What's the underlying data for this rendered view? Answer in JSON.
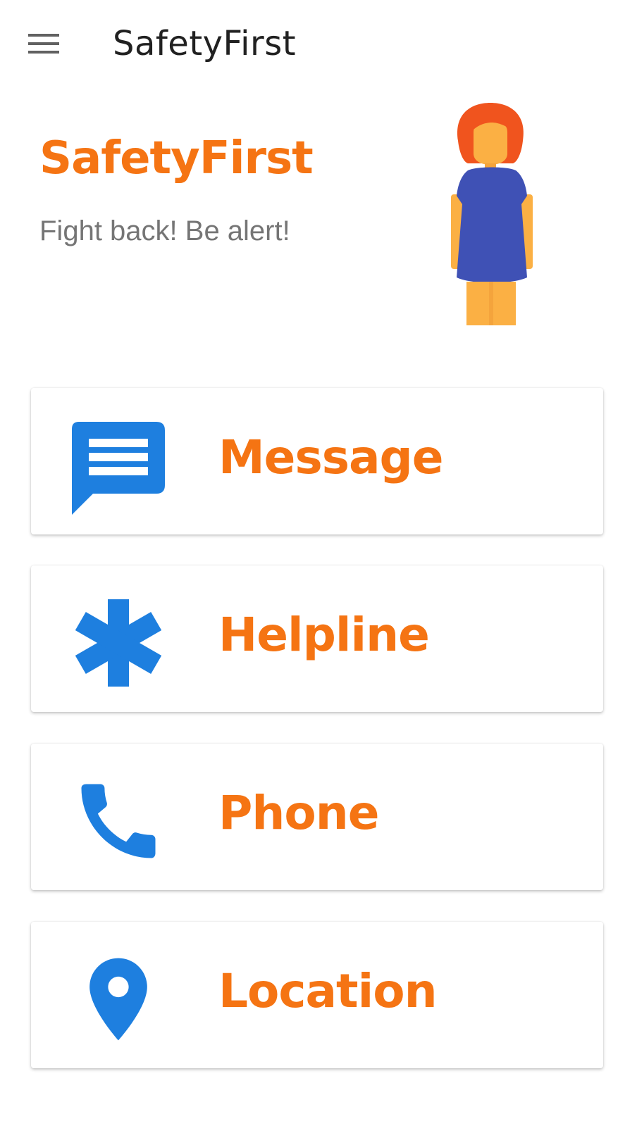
{
  "app_bar": {
    "title": "SafetyFirst",
    "menu_icon": "menu-icon"
  },
  "header": {
    "brand_title": "SafetyFirst",
    "tagline": "Fight back! Be alert!",
    "illustration": "woman-figure"
  },
  "colors": {
    "accent_orange": "#f57413",
    "icon_blue": "#1e7fdf",
    "text_dark": "#212121",
    "text_gray": "#757575"
  },
  "actions": [
    {
      "label": "Message",
      "icon": "message-icon"
    },
    {
      "label": "Helpline",
      "icon": "asterisk-icon"
    },
    {
      "label": "Phone",
      "icon": "phone-icon"
    },
    {
      "label": "Location",
      "icon": "location-pin-icon"
    }
  ]
}
